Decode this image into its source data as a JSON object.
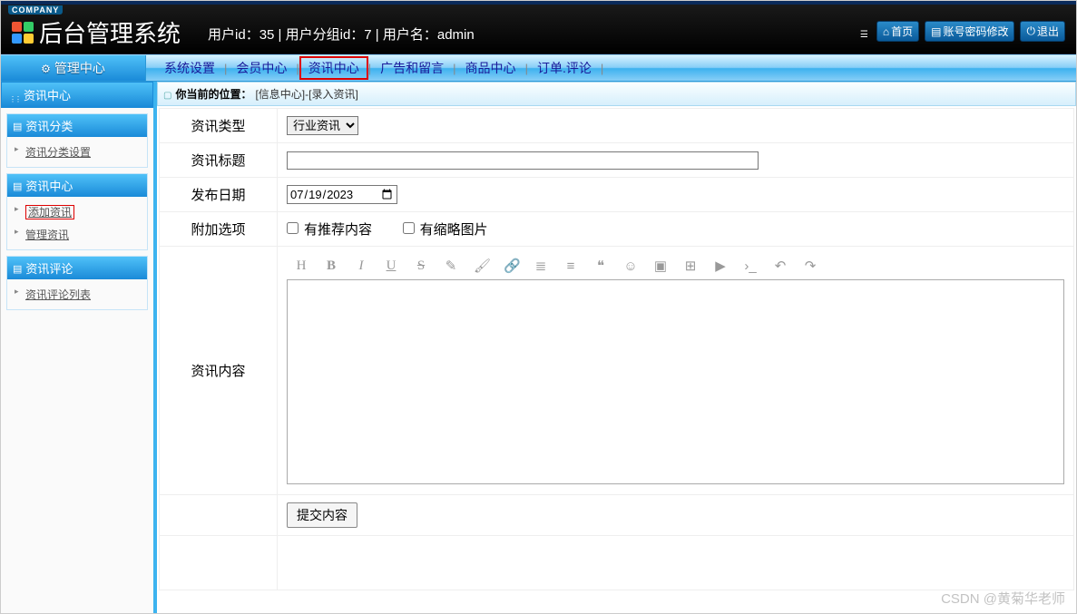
{
  "header": {
    "company_tag": "COMPANY",
    "app_title": "后台管理系统",
    "user_info": "用户id：35 | 用户分组id：7 | 用户名：admin",
    "links": {
      "home": "首页",
      "account": "账号密码修改",
      "logout": "退出"
    }
  },
  "nav": {
    "side_head": "管理中心",
    "items": [
      "系统设置",
      "会员中心",
      "资讯中心",
      "广告和留言",
      "商品中心",
      "订单.评论"
    ],
    "active_index": 2
  },
  "sidebar": {
    "title": "资讯中心",
    "groups": [
      {
        "title": "资讯分类",
        "items": [
          {
            "label": "资讯分类设置",
            "hl": false
          }
        ]
      },
      {
        "title": "资讯中心",
        "items": [
          {
            "label": "添加资讯",
            "hl": true
          },
          {
            "label": "管理资讯",
            "hl": false
          }
        ]
      },
      {
        "title": "资讯评论",
        "items": [
          {
            "label": "资讯评论列表",
            "hl": false
          }
        ]
      }
    ]
  },
  "crumb": {
    "prefix": "你当前的位置：",
    "path": "[信息中心]-[录入资讯]"
  },
  "form": {
    "type": {
      "label": "资讯类型",
      "options": [
        "行业资讯"
      ],
      "value": "行业资讯"
    },
    "title": {
      "label": "资讯标题",
      "value": ""
    },
    "date": {
      "label": "发布日期",
      "value": "2023/07/19"
    },
    "extra": {
      "label": "附加选项",
      "opt1": "有推荐内容",
      "opt2": "有缩略图片"
    },
    "content": {
      "label": "资讯内容"
    },
    "submit": "提交内容"
  },
  "editor_toolbar": [
    "H",
    "B",
    "I",
    "U",
    "S",
    "✎",
    "🖌",
    "🔗",
    "≣",
    "≡",
    "❝",
    "☺",
    "▣",
    "⊞",
    "▶",
    "›_",
    "↶",
    "↷"
  ],
  "watermark": "CSDN @黄菊华老师"
}
